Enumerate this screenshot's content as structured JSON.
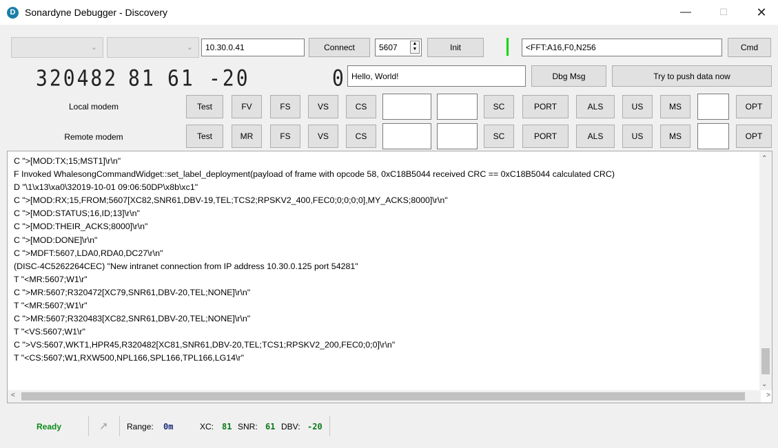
{
  "window": {
    "title": "Sonardyne Debugger - Discovery",
    "icon_letter": "D",
    "min_glyph": "—",
    "max_glyph": "☐",
    "close_glyph": "✕"
  },
  "toolbar": {
    "ip": "10.30.0.41",
    "connect_label": "Connect",
    "port": "5607",
    "init_label": "Init",
    "cmd_value": "<FFT:A16,F0,N256",
    "cmd_label": "Cmd"
  },
  "display": {
    "range_digits": "320482",
    "xc_digits": "81",
    "snr_digits": "61",
    "dbv_digits": "-20",
    "count_digit": "0",
    "msg_value": "Hello, World!",
    "dbg_msg_label": "Dbg Msg",
    "push_label": "Try to push data now"
  },
  "local_modem": {
    "label": "Local modem",
    "buttons": [
      "Test",
      "FV",
      "FS",
      "VS",
      "CS",
      "SC",
      "PORT",
      "ALS",
      "US",
      "MS",
      "OPT"
    ]
  },
  "remote_modem": {
    "label": "Remote modem",
    "buttons": [
      "Test",
      "MR",
      "FS",
      "VS",
      "CS",
      "SC",
      "PORT",
      "ALS",
      "US",
      "MS",
      "OPT"
    ]
  },
  "console_lines": [
    "C \">[MOD:TX;15;MST1]\\r\\n\"",
    "F Invoked WhalesongCommandWidget::set_label_deployment(payload of frame with opcode 58, 0xC18B5044 received CRC == 0xC18B5044 calculated CRC)",
    "D \"\\1\\x13\\xa0\\32019-10-01 09:06:50DP\\x8b\\xc1\"",
    "C \">[MOD:RX;15,FROM;5607[XC82,SNR61,DBV-19,TEL;TCS2;RPSKV2_400,FEC0;0;0;0;0],MY_ACKS;8000]\\r\\n\"",
    "C \">[MOD:STATUS;16,ID;13]\\r\\n\"",
    "C \">[MOD:THEIR_ACKS;8000]\\r\\n\"",
    "C \">[MOD:DONE]\\r\\n\"",
    "C \">MDFT:5607,LDA0,RDA0,DC27\\r\\n\"",
    "(DISC-4C5262264CEC) \"New intranet connection from IP address 10.30.0.125 port 54281\"",
    "T \"<MR:5607;W1\\r\"",
    "C \">MR:5607;R320472[XC79,SNR61,DBV-20,TEL;NONE]\\r\\n\"",
    "T \"<MR:5607;W1\\r\"",
    "C \">MR:5607;R320483[XC82,SNR61,DBV-20,TEL;NONE]\\r\\n\"",
    "T \"<VS:5607;W1\\r\"",
    "C \">VS:5607,WKT1,HPR45,R320482[XC81,SNR61,DBV-20,TEL;TCS1;RPSKV2_200,FEC0;0;0]\\r\\n\"",
    "T \"<CS:5607;W1,RXW500,NPL166,SPL166,TPL166,LG14\\r\""
  ],
  "statusbar": {
    "state": "Ready",
    "range_label": "Range:",
    "range_value": "0m",
    "xc_label": "XC:",
    "xc_value": "81",
    "snr_label": "SNR:",
    "snr_value": "61",
    "dbv_label": "DBV:",
    "dbv_value": "-20"
  },
  "icons": {
    "chevron": "chevron-down-icon",
    "arrow": "arrow-up-right-icon",
    "spin": "spin-arrows-icon"
  }
}
